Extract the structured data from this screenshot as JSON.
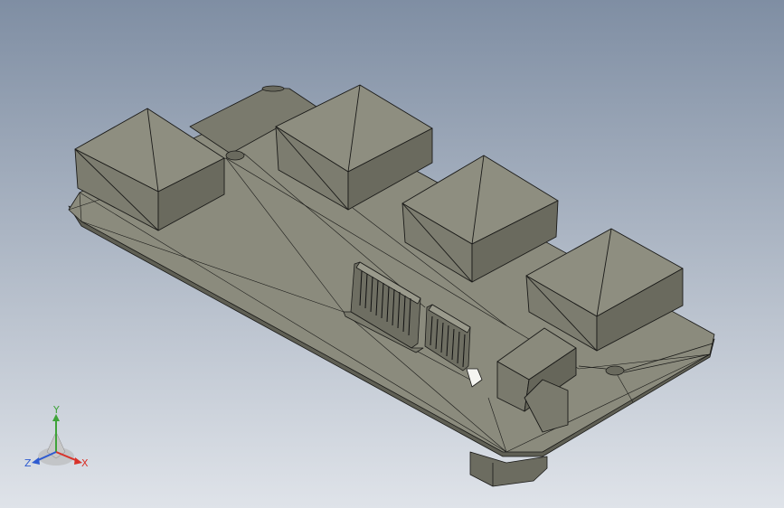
{
  "viewport": {
    "background_top": "#7f8ea3",
    "background_bottom": "#dfe3e9",
    "model_face_light": "#8b8b7d",
    "model_face_mid": "#77776a",
    "model_face_dark": "#5f5f54",
    "edge_color": "#1a1a18"
  },
  "triad": {
    "x_label": "X",
    "y_label": "Y",
    "z_label": "Z",
    "x_color": "#d8322a",
    "y_color": "#3fa33a",
    "z_color": "#2f5bd0"
  }
}
